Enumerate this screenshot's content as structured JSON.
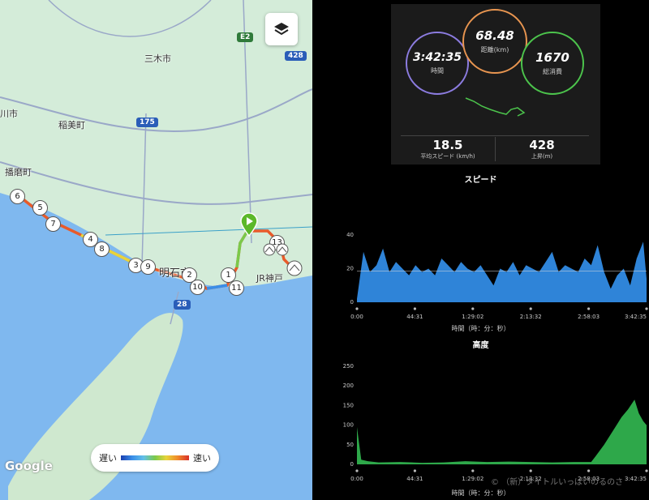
{
  "map": {
    "places": [
      {
        "name": "三木市"
      },
      {
        "name": "川市"
      },
      {
        "name": "稲美町"
      },
      {
        "name": "播磨町"
      },
      {
        "name": "明石市"
      },
      {
        "name": "JR神戸"
      }
    ],
    "road_shields": [
      "E2",
      "428",
      "175",
      "28"
    ],
    "markers": [
      "1",
      "2",
      "3",
      "4",
      "5",
      "6",
      "7",
      "8",
      "9",
      "10",
      "11",
      "13"
    ],
    "logo": "Google",
    "legend": {
      "slow": "遅い",
      "fast": "速い"
    },
    "colors": {
      "route_fast": "#d8302a",
      "route_slow": "#1a3fb0",
      "start": "#5cb82a"
    }
  },
  "summary": {
    "duration": {
      "value": "3:42:35",
      "label": "時間"
    },
    "distance": {
      "value": "68.48",
      "label": "距離(km)"
    },
    "calories": {
      "value": "1670",
      "label": "総消費"
    },
    "avg_speed": {
      "value": "18.5",
      "label": "平均スピード (km/h)"
    },
    "ascent": {
      "value": "428",
      "label": "上昇(m)"
    }
  },
  "chart_data": [
    {
      "type": "area",
      "title": "スピード",
      "xlabel": "時間（時：分：秒）",
      "x_ticks": [
        "0:00",
        "44:31",
        "1:29:02",
        "2:13:32",
        "2:58:03",
        "3:42:35"
      ],
      "y_ticks": [
        0,
        20,
        40
      ],
      "ylim": [
        0,
        40
      ],
      "reference_line": 18.5,
      "color": "#2f84d8",
      "x_seconds": [
        0,
        300,
        600,
        900,
        1200,
        1500,
        1800,
        2100,
        2400,
        2700,
        3000,
        3300,
        3600,
        3900,
        4200,
        4500,
        4800,
        5100,
        5400,
        5700,
        6000,
        6300,
        6600,
        6900,
        7200,
        7500,
        7800,
        8100,
        8400,
        8700,
        9000,
        9300,
        9600,
        9900,
        10200,
        10500,
        10800,
        11100,
        11400,
        11700,
        12000,
        12300,
        12600,
        12900,
        13200,
        13355
      ],
      "values": [
        2,
        30,
        18,
        22,
        32,
        18,
        24,
        20,
        16,
        22,
        18,
        20,
        16,
        26,
        22,
        18,
        24,
        20,
        18,
        22,
        16,
        10,
        20,
        18,
        24,
        16,
        22,
        20,
        18,
        24,
        30,
        18,
        22,
        20,
        18,
        26,
        22,
        34,
        18,
        8,
        16,
        20,
        10,
        26,
        36,
        14
      ]
    },
    {
      "type": "area",
      "title": "高度",
      "xlabel": "時間（時：分：秒）",
      "x_ticks": [
        "0:00",
        "44:31",
        "1:29:02",
        "2:13:32",
        "2:58:03",
        "3:42:35"
      ],
      "y_ticks": [
        0,
        50,
        100,
        150,
        200,
        250
      ],
      "ylim": [
        0,
        250
      ],
      "color": "#2ea84a",
      "x_seconds": [
        0,
        200,
        500,
        1000,
        2000,
        3000,
        4000,
        5000,
        6000,
        7000,
        8000,
        9000,
        10000,
        10800,
        11000,
        11400,
        11800,
        12200,
        12500,
        12800,
        13000,
        13200,
        13355
      ],
      "values": [
        95,
        12,
        8,
        5,
        6,
        4,
        5,
        8,
        6,
        7,
        6,
        5,
        6,
        6,
        20,
        50,
        85,
        120,
        140,
        165,
        130,
        110,
        100
      ]
    }
  ],
  "watermark": "© （新）タイトルいっぱいのるのさ"
}
